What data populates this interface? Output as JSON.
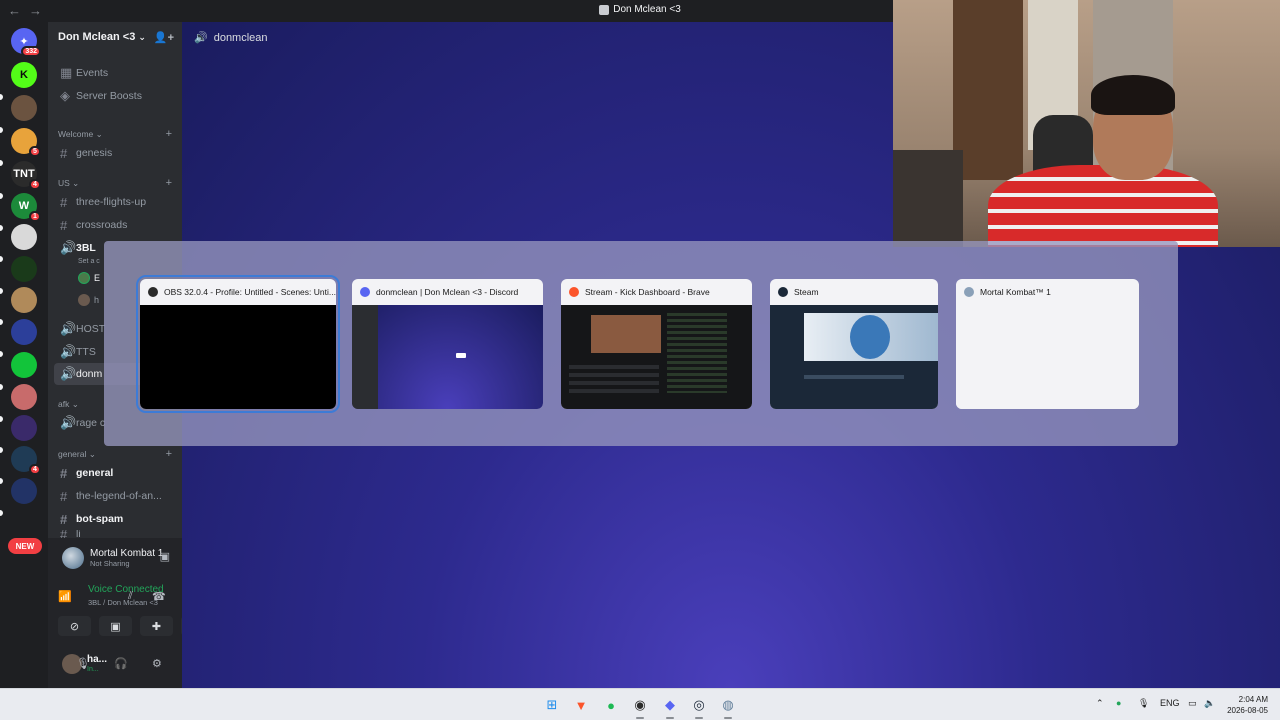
{
  "window": {
    "title": "Don Mclean <3",
    "nav_back": "←",
    "nav_forward": "→"
  },
  "rail": {
    "home_badge": "332",
    "servers": [
      {
        "label": "K",
        "color": "#53fc18",
        "text_color": "#0b0b0b",
        "badge": ""
      },
      {
        "label": "",
        "color": "#6b5340",
        "text_color": "#ffffff",
        "badge": ""
      },
      {
        "label": "",
        "color": "#e8a33b",
        "text_color": "#ffffff",
        "badge": "5"
      },
      {
        "label": "TNT",
        "color": "#2b2b2b",
        "text_color": "#ffffff",
        "badge": "4"
      },
      {
        "label": "W",
        "color": "#1c8a3a",
        "text_color": "#ffffff",
        "badge": "1"
      },
      {
        "label": "",
        "color": "#d9d9d9",
        "text_color": "#111111",
        "badge": ""
      },
      {
        "label": "",
        "color": "#1a3a1a",
        "text_color": "#22ff55",
        "badge": ""
      },
      {
        "label": "",
        "color": "#b08a5a",
        "text_color": "#ffffff",
        "badge": ""
      },
      {
        "label": "",
        "color": "#2c3f9a",
        "text_color": "#ffffff",
        "badge": ""
      },
      {
        "label": "",
        "color": "#12c43a",
        "text_color": "#ffffff",
        "badge": ""
      },
      {
        "label": "",
        "color": "#c86b6b",
        "text_color": "#ffffff",
        "badge": ""
      },
      {
        "label": "",
        "color": "#3a2a6a",
        "text_color": "#ffffff",
        "badge": ""
      },
      {
        "label": "",
        "color": "#1f3b55",
        "text_color": "#ffffff",
        "badge": "4"
      },
      {
        "label": "",
        "color": "#223366",
        "text_color": "#ffffff",
        "badge": ""
      }
    ],
    "new_label": "NEW"
  },
  "sidebar": {
    "server_name": "Don Mclean <3",
    "items": [
      {
        "type": "menu",
        "label": "Events",
        "icon": "calendar-icon"
      },
      {
        "type": "menu",
        "label": "Server Boosts",
        "icon": "boost-icon"
      }
    ],
    "categories": {
      "welcome": "Welcome",
      "us": "US",
      "afk": "afk",
      "general": "general"
    },
    "channels": {
      "genesis": "genesis",
      "three_flights_up": "three-flights-up",
      "crossroads": "crossroads",
      "threebl": "3BL",
      "threebl_sub": "Set a c",
      "host": "HOST",
      "tts": "TTS",
      "donm": "donm",
      "rage": "rage c",
      "general": "general",
      "legend": "the-legend-of-an...",
      "bot_spam": "bot-spam",
      "partial": "li"
    },
    "voice_users": [
      "E",
      "h"
    ]
  },
  "activity": {
    "title": "Mortal Kombat 1",
    "status": "Not Sharing"
  },
  "voice": {
    "status": "Voice Connected",
    "channel": "3BL / Don Mclean <3"
  },
  "user": {
    "name": "ha...",
    "status": "In..."
  },
  "main": {
    "channel_title": "donmclean"
  },
  "switcher": {
    "tiles": [
      {
        "title": "OBS 32.0.4 - Profile: Untitled - Scenes: Unti...",
        "icon_color": "#2b2b2b",
        "thumb": "black",
        "selected": true
      },
      {
        "title": "donmclean | Don Mclean <3 - Discord",
        "icon_color": "#5865f2",
        "thumb": "discord",
        "selected": false
      },
      {
        "title": "Stream - Kick Dashboard - Brave",
        "icon_color": "#fb542b",
        "thumb": "kick",
        "selected": false
      },
      {
        "title": "Steam",
        "icon_color": "#1b2838",
        "thumb": "steam",
        "selected": false
      },
      {
        "title": "Mortal Kombat™ 1",
        "icon_color": "#8aa0b8",
        "thumb": "blank",
        "selected": false
      }
    ]
  },
  "taskbar": {
    "apps": [
      {
        "name": "windows-start-icon",
        "glyph": "⊞",
        "color": "#1f8ceb"
      },
      {
        "name": "brave-icon",
        "glyph": "▼",
        "color": "#fb542b"
      },
      {
        "name": "spotify-icon",
        "glyph": "●",
        "color": "#1db954"
      },
      {
        "name": "obs-icon",
        "glyph": "◉",
        "color": "#2b2b2b"
      },
      {
        "name": "discord-icon",
        "glyph": "◆",
        "color": "#5865f2"
      },
      {
        "name": "steam-icon",
        "glyph": "◎",
        "color": "#1b2838"
      },
      {
        "name": "mortal-kombat-icon",
        "glyph": "◍",
        "color": "#607d99"
      }
    ],
    "tray_lang": "ENG",
    "time": "2:04 AM",
    "date": "2026-08-05"
  },
  "colors": {
    "discord_bg": "#1e1f22",
    "sidebar_bg": "#2b2d31",
    "voice_green": "#23a55a",
    "accent_select": "#3d7bd6"
  }
}
